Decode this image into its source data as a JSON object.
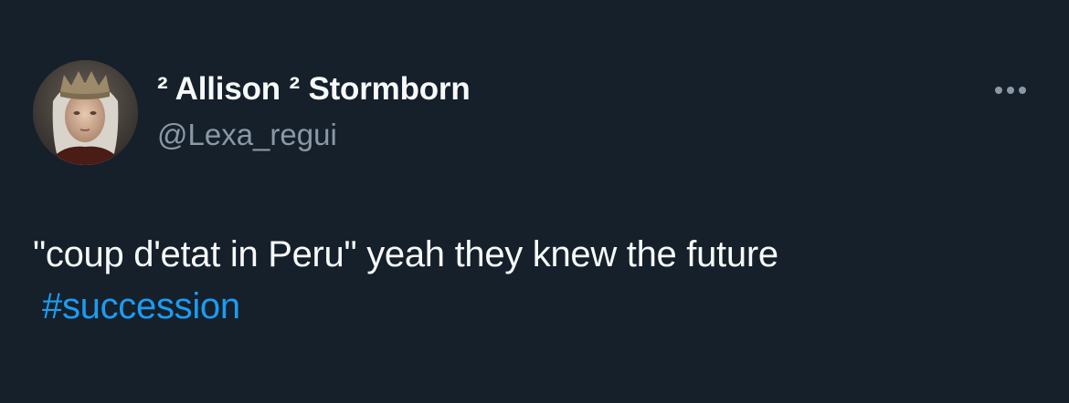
{
  "tweet": {
    "author": {
      "display_name": "² Allison ² Stormborn",
      "handle": "@Lexa_regui",
      "avatar_icon": "user-avatar"
    },
    "text": "\"coup d'etat in Peru\" yeah they knew the future",
    "hashtag": "#succession",
    "more_icon": "more-horizontal-icon"
  },
  "colors": {
    "background": "#15202b",
    "primary_text": "#f7f9f9",
    "secondary_text": "#8b98a5",
    "link": "#1d9bf0"
  }
}
